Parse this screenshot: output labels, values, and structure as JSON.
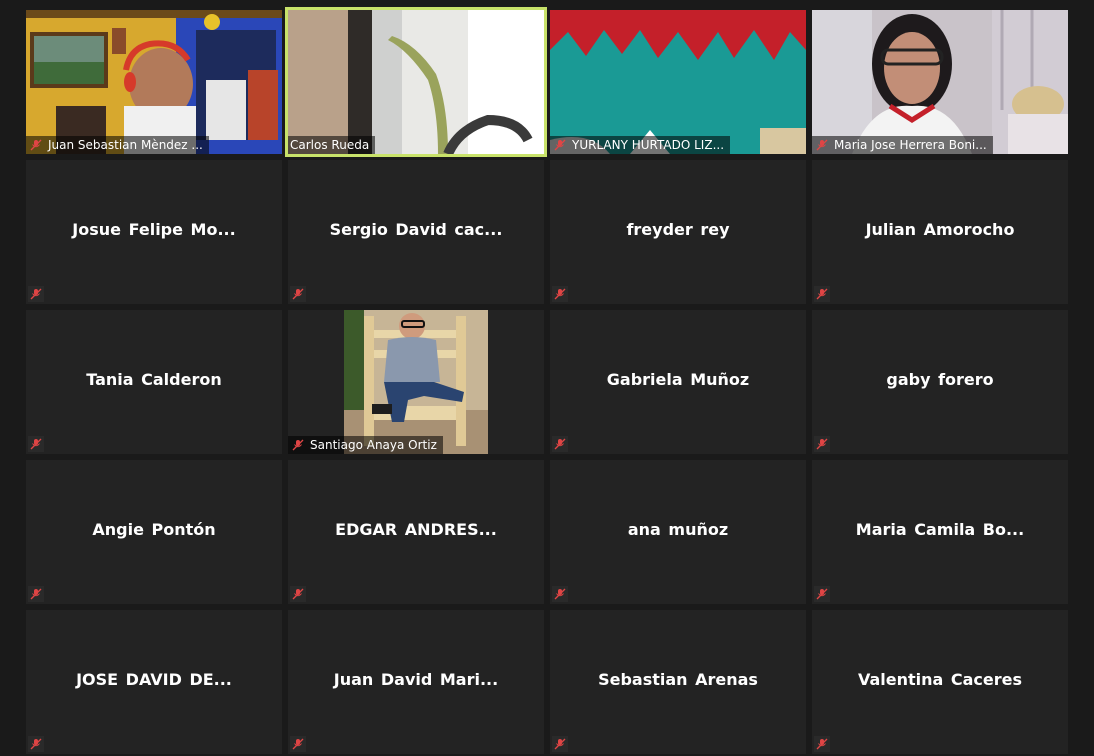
{
  "meeting": {
    "layout": "gallery",
    "accent_speaker_color": "#c8e26a",
    "muted_icon": "mic-muted-icon",
    "participants": [
      {
        "name": "Juan Sebastian Mèndez ...",
        "video": true
      },
      {
        "name": "Carlos Rueda",
        "video": true,
        "active_speaker": true
      },
      {
        "name": "YURLANY HURTADO LIZ...",
        "video": true
      },
      {
        "name": "Maria Jose Herrera Boni...",
        "video": true
      },
      {
        "name": "Josue  Felipe  Mo...",
        "video": false
      },
      {
        "name": "Sergio  David  cac...",
        "video": false
      },
      {
        "name": "freyder rey",
        "video": false
      },
      {
        "name": "Julian Amorocho",
        "video": false
      },
      {
        "name": "Tania Calderon",
        "video": false
      },
      {
        "name": "Santiago Anaya Ortiz",
        "video": false,
        "profile_photo": true
      },
      {
        "name": "Gabriela Muñoz",
        "video": false
      },
      {
        "name": "gaby forero",
        "video": false
      },
      {
        "name": "Angie Pontón",
        "video": false
      },
      {
        "name": "EDGAR  ANDRES...",
        "video": false
      },
      {
        "name": "ana muñoz",
        "video": false
      },
      {
        "name": "Maria  Camila  Bo...",
        "video": false
      },
      {
        "name": "JOSE DAVID DE...",
        "video": false
      },
      {
        "name": "Juan  David  Mari...",
        "video": false
      },
      {
        "name": "Sebastian Arenas",
        "video": false
      },
      {
        "name": "Valentina Caceres",
        "video": false
      }
    ]
  }
}
